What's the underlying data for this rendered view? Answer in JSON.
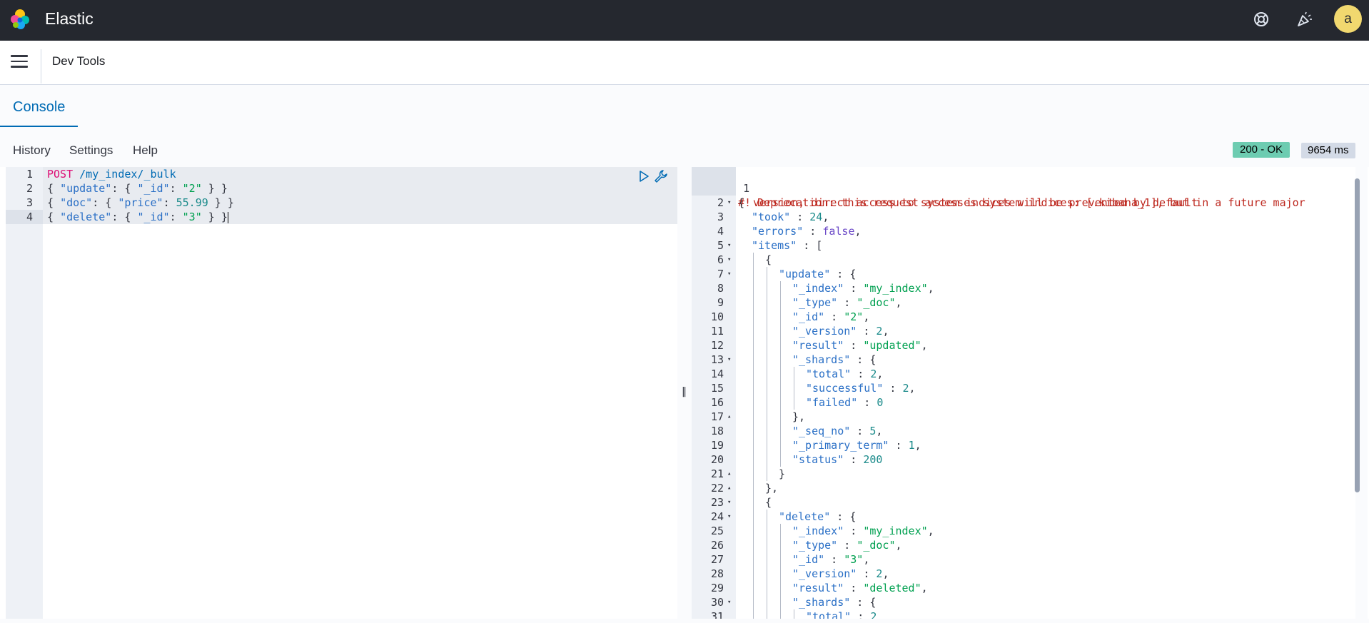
{
  "app": {
    "brand": "Elastic",
    "avatar_initial": "a",
    "icons": [
      "elastic-logo-icon",
      "help-icon",
      "newsfeed-icon",
      "menu-icon"
    ]
  },
  "header": {
    "title": "Dev Tools"
  },
  "tabs": {
    "console": "Console"
  },
  "toolbar": {
    "history": "History",
    "settings": "Settings",
    "help": "Help"
  },
  "status": {
    "code": "200 - OK",
    "time": "9654 ms",
    "ok_color": "#6dccb1"
  },
  "request": {
    "lines": [
      {
        "n": "1",
        "parts": [
          {
            "t": "POST ",
            "c": "k-method"
          },
          {
            "t": "/my_index/_bulk",
            "c": "k-url"
          }
        ]
      },
      {
        "n": "2",
        "parts": [
          {
            "t": "{ ",
            "c": "k-punc"
          },
          {
            "t": "\"update\"",
            "c": "k-key"
          },
          {
            "t": ": { ",
            "c": "k-punc"
          },
          {
            "t": "\"_id\"",
            "c": "k-key"
          },
          {
            "t": ": ",
            "c": "k-punc"
          },
          {
            "t": "\"2\"",
            "c": "k-str"
          },
          {
            "t": " } }",
            "c": "k-punc"
          }
        ]
      },
      {
        "n": "3",
        "parts": [
          {
            "t": "{ ",
            "c": "k-punc"
          },
          {
            "t": "\"doc\"",
            "c": "k-key"
          },
          {
            "t": ": { ",
            "c": "k-punc"
          },
          {
            "t": "\"price\"",
            "c": "k-key"
          },
          {
            "t": ": ",
            "c": "k-punc"
          },
          {
            "t": "55.99",
            "c": "k-num"
          },
          {
            "t": " } }",
            "c": "k-punc"
          }
        ]
      },
      {
        "n": "4",
        "parts": [
          {
            "t": "{ ",
            "c": "k-punc"
          },
          {
            "t": "\"delete\"",
            "c": "k-key"
          },
          {
            "t": ": { ",
            "c": "k-punc"
          },
          {
            "t": "\"_id\"",
            "c": "k-key"
          },
          {
            "t": ": ",
            "c": "k-punc"
          },
          {
            "t": "\"3\"",
            "c": "k-str"
          },
          {
            "t": " } }",
            "c": "k-punc"
          }
        ]
      }
    ]
  },
  "response": {
    "warning_line1": "#! Deprecation: this request accesses system indices: [.kibana_1], but in a future major",
    "warning_line2": "version, direct access to system indices will be prevented by default",
    "lines": [
      {
        "n": "2",
        "fold": "down",
        "indent": 0,
        "parts": [
          {
            "t": "{",
            "c": "k-punc"
          }
        ]
      },
      {
        "n": "3",
        "indent": 1,
        "parts": [
          {
            "t": "\"took\"",
            "c": "k-key"
          },
          {
            "t": " : ",
            "c": "k-punc"
          },
          {
            "t": "24",
            "c": "k-num"
          },
          {
            "t": ",",
            "c": "k-punc"
          }
        ]
      },
      {
        "n": "4",
        "indent": 1,
        "parts": [
          {
            "t": "\"errors\"",
            "c": "k-key"
          },
          {
            "t": " : ",
            "c": "k-punc"
          },
          {
            "t": "false",
            "c": "k-bool"
          },
          {
            "t": ",",
            "c": "k-punc"
          }
        ]
      },
      {
        "n": "5",
        "fold": "down",
        "indent": 1,
        "parts": [
          {
            "t": "\"items\"",
            "c": "k-key"
          },
          {
            "t": " : [",
            "c": "k-punc"
          }
        ]
      },
      {
        "n": "6",
        "fold": "down",
        "indent": 2,
        "parts": [
          {
            "t": "{",
            "c": "k-punc"
          }
        ]
      },
      {
        "n": "7",
        "fold": "down",
        "indent": 3,
        "parts": [
          {
            "t": "\"update\"",
            "c": "k-key"
          },
          {
            "t": " : {",
            "c": "k-punc"
          }
        ]
      },
      {
        "n": "8",
        "indent": 4,
        "parts": [
          {
            "t": "\"_index\"",
            "c": "k-key"
          },
          {
            "t": " : ",
            "c": "k-punc"
          },
          {
            "t": "\"my_index\"",
            "c": "k-str"
          },
          {
            "t": ",",
            "c": "k-punc"
          }
        ]
      },
      {
        "n": "9",
        "indent": 4,
        "parts": [
          {
            "t": "\"_type\"",
            "c": "k-key"
          },
          {
            "t": " : ",
            "c": "k-punc"
          },
          {
            "t": "\"_doc\"",
            "c": "k-str"
          },
          {
            "t": ",",
            "c": "k-punc"
          }
        ]
      },
      {
        "n": "10",
        "indent": 4,
        "parts": [
          {
            "t": "\"_id\"",
            "c": "k-key"
          },
          {
            "t": " : ",
            "c": "k-punc"
          },
          {
            "t": "\"2\"",
            "c": "k-str"
          },
          {
            "t": ",",
            "c": "k-punc"
          }
        ]
      },
      {
        "n": "11",
        "indent": 4,
        "parts": [
          {
            "t": "\"_version\"",
            "c": "k-key"
          },
          {
            "t": " : ",
            "c": "k-punc"
          },
          {
            "t": "2",
            "c": "k-num"
          },
          {
            "t": ",",
            "c": "k-punc"
          }
        ]
      },
      {
        "n": "12",
        "indent": 4,
        "parts": [
          {
            "t": "\"result\"",
            "c": "k-key"
          },
          {
            "t": " : ",
            "c": "k-punc"
          },
          {
            "t": "\"updated\"",
            "c": "k-str"
          },
          {
            "t": ",",
            "c": "k-punc"
          }
        ]
      },
      {
        "n": "13",
        "fold": "down",
        "indent": 4,
        "parts": [
          {
            "t": "\"_shards\"",
            "c": "k-key"
          },
          {
            "t": " : {",
            "c": "k-punc"
          }
        ]
      },
      {
        "n": "14",
        "indent": 5,
        "parts": [
          {
            "t": "\"total\"",
            "c": "k-key"
          },
          {
            "t": " : ",
            "c": "k-punc"
          },
          {
            "t": "2",
            "c": "k-num"
          },
          {
            "t": ",",
            "c": "k-punc"
          }
        ]
      },
      {
        "n": "15",
        "indent": 5,
        "parts": [
          {
            "t": "\"successful\"",
            "c": "k-key"
          },
          {
            "t": " : ",
            "c": "k-punc"
          },
          {
            "t": "2",
            "c": "k-num"
          },
          {
            "t": ",",
            "c": "k-punc"
          }
        ]
      },
      {
        "n": "16",
        "indent": 5,
        "parts": [
          {
            "t": "\"failed\"",
            "c": "k-key"
          },
          {
            "t": " : ",
            "c": "k-punc"
          },
          {
            "t": "0",
            "c": "k-num"
          }
        ]
      },
      {
        "n": "17",
        "fold": "up",
        "indent": 4,
        "parts": [
          {
            "t": "},",
            "c": "k-punc"
          }
        ]
      },
      {
        "n": "18",
        "indent": 4,
        "parts": [
          {
            "t": "\"_seq_no\"",
            "c": "k-key"
          },
          {
            "t": " : ",
            "c": "k-punc"
          },
          {
            "t": "5",
            "c": "k-num"
          },
          {
            "t": ",",
            "c": "k-punc"
          }
        ]
      },
      {
        "n": "19",
        "indent": 4,
        "parts": [
          {
            "t": "\"_primary_term\"",
            "c": "k-key"
          },
          {
            "t": " : ",
            "c": "k-punc"
          },
          {
            "t": "1",
            "c": "k-num"
          },
          {
            "t": ",",
            "c": "k-punc"
          }
        ]
      },
      {
        "n": "20",
        "indent": 4,
        "parts": [
          {
            "t": "\"status\"",
            "c": "k-key"
          },
          {
            "t": " : ",
            "c": "k-punc"
          },
          {
            "t": "200",
            "c": "k-num"
          }
        ]
      },
      {
        "n": "21",
        "fold": "up",
        "indent": 3,
        "parts": [
          {
            "t": "}",
            "c": "k-punc"
          }
        ]
      },
      {
        "n": "22",
        "fold": "up",
        "indent": 2,
        "parts": [
          {
            "t": "},",
            "c": "k-punc"
          }
        ]
      },
      {
        "n": "23",
        "fold": "down",
        "indent": 2,
        "parts": [
          {
            "t": "{",
            "c": "k-punc"
          }
        ]
      },
      {
        "n": "24",
        "fold": "down",
        "indent": 3,
        "parts": [
          {
            "t": "\"delete\"",
            "c": "k-key"
          },
          {
            "t": " : {",
            "c": "k-punc"
          }
        ]
      },
      {
        "n": "25",
        "indent": 4,
        "parts": [
          {
            "t": "\"_index\"",
            "c": "k-key"
          },
          {
            "t": " : ",
            "c": "k-punc"
          },
          {
            "t": "\"my_index\"",
            "c": "k-str"
          },
          {
            "t": ",",
            "c": "k-punc"
          }
        ]
      },
      {
        "n": "26",
        "indent": 4,
        "parts": [
          {
            "t": "\"_type\"",
            "c": "k-key"
          },
          {
            "t": " : ",
            "c": "k-punc"
          },
          {
            "t": "\"_doc\"",
            "c": "k-str"
          },
          {
            "t": ",",
            "c": "k-punc"
          }
        ]
      },
      {
        "n": "27",
        "indent": 4,
        "parts": [
          {
            "t": "\"_id\"",
            "c": "k-key"
          },
          {
            "t": " : ",
            "c": "k-punc"
          },
          {
            "t": "\"3\"",
            "c": "k-str"
          },
          {
            "t": ",",
            "c": "k-punc"
          }
        ]
      },
      {
        "n": "28",
        "indent": 4,
        "parts": [
          {
            "t": "\"_version\"",
            "c": "k-key"
          },
          {
            "t": " : ",
            "c": "k-punc"
          },
          {
            "t": "2",
            "c": "k-num"
          },
          {
            "t": ",",
            "c": "k-punc"
          }
        ]
      },
      {
        "n": "29",
        "indent": 4,
        "parts": [
          {
            "t": "\"result\"",
            "c": "k-key"
          },
          {
            "t": " : ",
            "c": "k-punc"
          },
          {
            "t": "\"deleted\"",
            "c": "k-str"
          },
          {
            "t": ",",
            "c": "k-punc"
          }
        ]
      },
      {
        "n": "30",
        "fold": "down",
        "indent": 4,
        "parts": [
          {
            "t": "\"_shards\"",
            "c": "k-key"
          },
          {
            "t": " : {",
            "c": "k-punc"
          }
        ]
      },
      {
        "n": "31",
        "indent": 5,
        "parts": [
          {
            "t": "\"total\"",
            "c": "k-key"
          },
          {
            "t": " : ",
            "c": "k-punc"
          },
          {
            "t": "2",
            "c": "k-num"
          }
        ]
      }
    ]
  }
}
